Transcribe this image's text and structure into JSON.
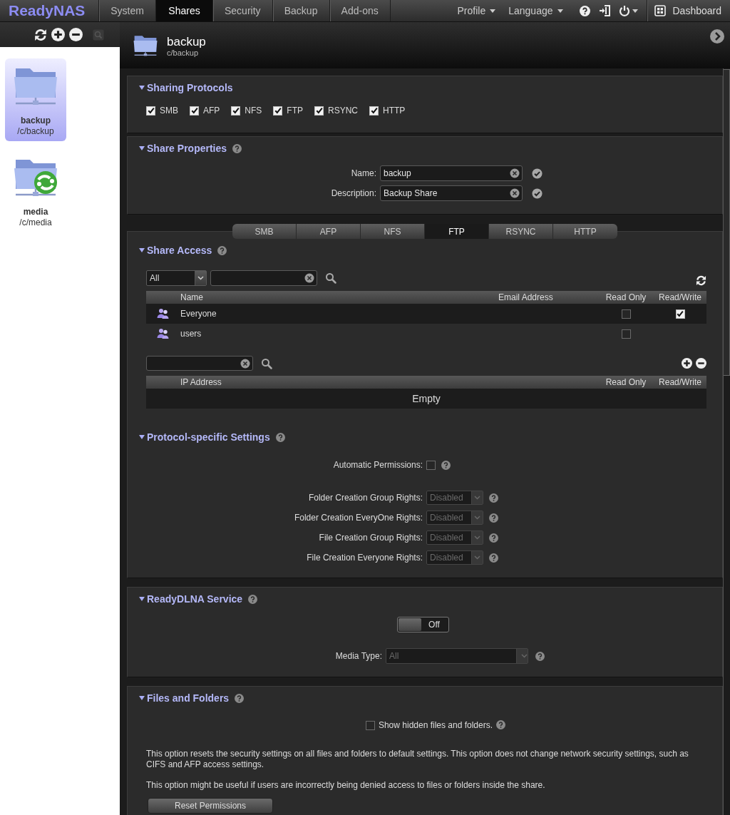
{
  "top_nav": {
    "logo": "ReadyNAS",
    "tabs": [
      {
        "label": "System",
        "selected": false
      },
      {
        "label": "Shares",
        "selected": true
      },
      {
        "label": "Security",
        "selected": false
      },
      {
        "label": "Backup",
        "selected": false
      },
      {
        "label": "Add-ons",
        "selected": false
      }
    ],
    "menus": [
      "Profile",
      "Language"
    ],
    "dashboard": "Dashboard"
  },
  "sidebar": {
    "shares": [
      {
        "name": "backup",
        "path": "/c/backup",
        "selected": true,
        "kind": "folder"
      },
      {
        "name": "media",
        "path": "/c/media",
        "selected": false,
        "kind": "media"
      }
    ]
  },
  "header": {
    "title": "backup",
    "subtitle": "c/backup"
  },
  "sharing_protocols": {
    "title": "Sharing Protocols",
    "help": false,
    "options": [
      {
        "label": "SMB",
        "checked": true
      },
      {
        "label": "AFP",
        "checked": true
      },
      {
        "label": "NFS",
        "checked": true
      },
      {
        "label": "FTP",
        "checked": true
      },
      {
        "label": "RSYNC",
        "checked": true
      },
      {
        "label": "HTTP",
        "checked": true
      }
    ]
  },
  "share_properties": {
    "title": "Share Properties",
    "help": true,
    "fields": [
      {
        "label": "Name:",
        "value": "backup"
      },
      {
        "label": "Description:",
        "value": "Backup Share"
      }
    ]
  },
  "protocol_tabs": [
    {
      "label": "SMB",
      "selected": false
    },
    {
      "label": "AFP",
      "selected": false
    },
    {
      "label": "NFS",
      "selected": false
    },
    {
      "label": "FTP",
      "selected": true
    },
    {
      "label": "RSYNC",
      "selected": false
    },
    {
      "label": "HTTP",
      "selected": false
    }
  ],
  "share_access": {
    "title": "Share Access",
    "help": true,
    "filter": "All",
    "user_columns": [
      "Name",
      "Email Address",
      "Read Only",
      "Read/Write"
    ],
    "users": [
      {
        "name": "Everyone",
        "read_only": false,
        "read_write": true
      },
      {
        "name": "users",
        "read_only": false
      }
    ],
    "ip_columns": [
      "IP Address",
      "Read Only",
      "Read/Write"
    ],
    "ip_empty": "Empty"
  },
  "protocol_settings": {
    "title": "Protocol-specific Settings",
    "help": true,
    "automatic_permissions": {
      "label": "Automatic Permissions:",
      "checked": false
    },
    "rights": [
      {
        "label": "Folder Creation Group Rights:",
        "value": "Disabled",
        "disabled": true
      },
      {
        "label": "Folder Creation EveryOne Rights:",
        "value": "Disabled",
        "disabled": true
      },
      {
        "label": "File Creation Group Rights:",
        "value": "Disabled",
        "disabled": true
      },
      {
        "label": "File Creation Everyone Rights:",
        "value": "Disabled",
        "disabled": true
      }
    ]
  },
  "readydlna": {
    "title": "ReadyDLNA Service",
    "help": true,
    "toggle": {
      "label": "Off",
      "on": false
    },
    "media_type": {
      "label": "Media Type:",
      "value": "All",
      "disabled": true
    }
  },
  "files_and_folders": {
    "title": "Files and Folders",
    "help": true,
    "show_hidden": {
      "label": "Show hidden files and folders.",
      "checked": false
    },
    "paragraphs": [
      "This option resets the security settings on all files and folders to default settings. This option does not change network security settings, such as CIFS and AFP access settings.",
      "This option might be useful if users are incorrectly being denied access to files or folders inside the share."
    ],
    "button": "Reset Permissions"
  }
}
